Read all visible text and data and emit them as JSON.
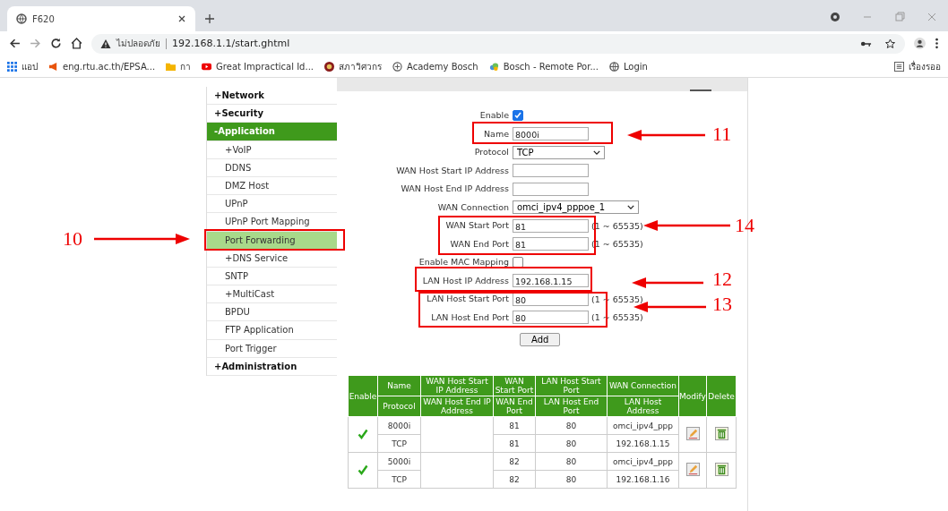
{
  "browser": {
    "tab_title": "F620",
    "security_label": "ไม่ปลอดภัย",
    "url": "192.168.1.1/start.ghtml",
    "bookmarks": [
      {
        "label": "แอป",
        "kind": "apps"
      },
      {
        "label": "eng.rtu.ac.th/EPSA...",
        "kind": "megaphone"
      },
      {
        "label": "กา",
        "kind": "folder"
      },
      {
        "label": "Great Impractical Id...",
        "kind": "video"
      },
      {
        "label": "สภาวิศวกร",
        "kind": "seal"
      },
      {
        "label": "Academy Bosch",
        "kind": "badge"
      },
      {
        "label": "Bosch - Remote Por...",
        "kind": "cloud"
      },
      {
        "label": "Login",
        "kind": "globe"
      }
    ],
    "reading_list": "เรื่องรออ"
  },
  "sidebar": {
    "items": [
      {
        "label": "+Network",
        "expanded": false
      },
      {
        "label": "+Security",
        "expanded": false
      },
      {
        "label": "-Application",
        "expanded": true,
        "children": [
          {
            "label": "+VoIP",
            "selected": false
          },
          {
            "label": "DDNS",
            "selected": false
          },
          {
            "label": "DMZ Host",
            "selected": false
          },
          {
            "label": "UPnP",
            "selected": false
          },
          {
            "label": "UPnP Port Mapping",
            "selected": false
          },
          {
            "label": "Port Forwarding",
            "selected": true
          },
          {
            "label": "+DNS Service",
            "selected": false
          },
          {
            "label": "SNTP",
            "selected": false
          },
          {
            "label": "+MultiCast",
            "selected": false
          },
          {
            "label": "BPDU",
            "selected": false
          },
          {
            "label": "FTP Application",
            "selected": false
          },
          {
            "label": "Port Trigger",
            "selected": false
          }
        ]
      },
      {
        "label": "+Administration",
        "expanded": false
      }
    ]
  },
  "form": {
    "fields": [
      {
        "label": "Enable",
        "kind": "checkbox",
        "checked": true
      },
      {
        "label": "Name",
        "kind": "text",
        "value": "8000i"
      },
      {
        "label": "Protocol",
        "kind": "select",
        "value": "TCP"
      },
      {
        "label": "WAN Host Start IP Address",
        "kind": "text"
      },
      {
        "label": "WAN Host End IP Address",
        "kind": "text"
      },
      {
        "label": "WAN Connection",
        "kind": "select",
        "value": "omci_ipv4_pppoe_1"
      },
      {
        "label": "WAN Start Port",
        "kind": "text",
        "value": "81",
        "hint": "(1 ~ 65535)"
      },
      {
        "label": "WAN End Port",
        "kind": "text",
        "value": "81",
        "hint": "(1 ~ 65535)"
      },
      {
        "label": "Enable MAC Mapping",
        "kind": "checkbox",
        "checked": false
      },
      {
        "label": "LAN Host IP Address",
        "kind": "text",
        "value": "192.168.1.15"
      },
      {
        "label": "LAN Host Start Port",
        "kind": "text",
        "value": "80",
        "hint": "(1 ~ 65535)"
      },
      {
        "label": "LAN Host End Port",
        "kind": "text",
        "value": "80",
        "hint": "(1 ~ 65535)"
      }
    ],
    "add_button": "Add"
  },
  "table": {
    "header_top": [
      "Enable",
      "Name",
      "WAN Host Start IP Address",
      "WAN Start Port",
      "LAN Host Start Port",
      "WAN Connection",
      "Modify",
      "Delete"
    ],
    "header_bottom": [
      "Protocol",
      "WAN Host End IP Address",
      "WAN End Port",
      "LAN Host End Port",
      "LAN Host Address"
    ],
    "rows": [
      {
        "enabled": true,
        "name": "8000i",
        "protocol": "TCP",
        "wan_start_port": "81",
        "wan_end_port": "81",
        "lan_start_port": "80",
        "lan_end_port": "80",
        "wan_connection": "omci_ipv4_ppp",
        "lan_host_address": "192.168.1.15"
      },
      {
        "enabled": true,
        "name": "5000i",
        "protocol": "TCP",
        "wan_start_port": "82",
        "wan_end_port": "82",
        "lan_start_port": "80",
        "lan_end_port": "80",
        "wan_connection": "omci_ipv4_ppp",
        "lan_host_address": "192.168.1.16"
      }
    ]
  },
  "annotations": [
    {
      "label": "10"
    },
    {
      "label": "11"
    },
    {
      "label": "14"
    },
    {
      "label": "12"
    },
    {
      "label": "13"
    }
  ]
}
